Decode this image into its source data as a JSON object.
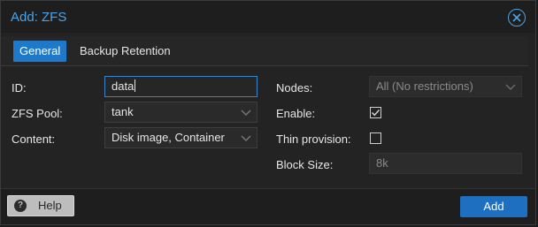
{
  "window": {
    "title": "Add: ZFS"
  },
  "tabs": [
    {
      "label": "General",
      "active": true
    },
    {
      "label": "Backup Retention",
      "active": false
    }
  ],
  "form": {
    "left": {
      "id": {
        "label": "ID:",
        "value": "data"
      },
      "zfs_pool": {
        "label": "ZFS Pool:",
        "value": "tank"
      },
      "content": {
        "label": "Content:",
        "value": "Disk image, Container"
      }
    },
    "right": {
      "nodes": {
        "label": "Nodes:",
        "value": "All (No restrictions)"
      },
      "enable": {
        "label": "Enable:",
        "checked": true
      },
      "thin_provision": {
        "label": "Thin provision:",
        "checked": false
      },
      "block_size": {
        "label": "Block Size:",
        "value": "8k"
      }
    }
  },
  "footer": {
    "help_label": "Help",
    "help_icon": "?",
    "add_label": "Add"
  },
  "colors": {
    "accent": "#1f78c8",
    "title": "#4da3e8"
  }
}
